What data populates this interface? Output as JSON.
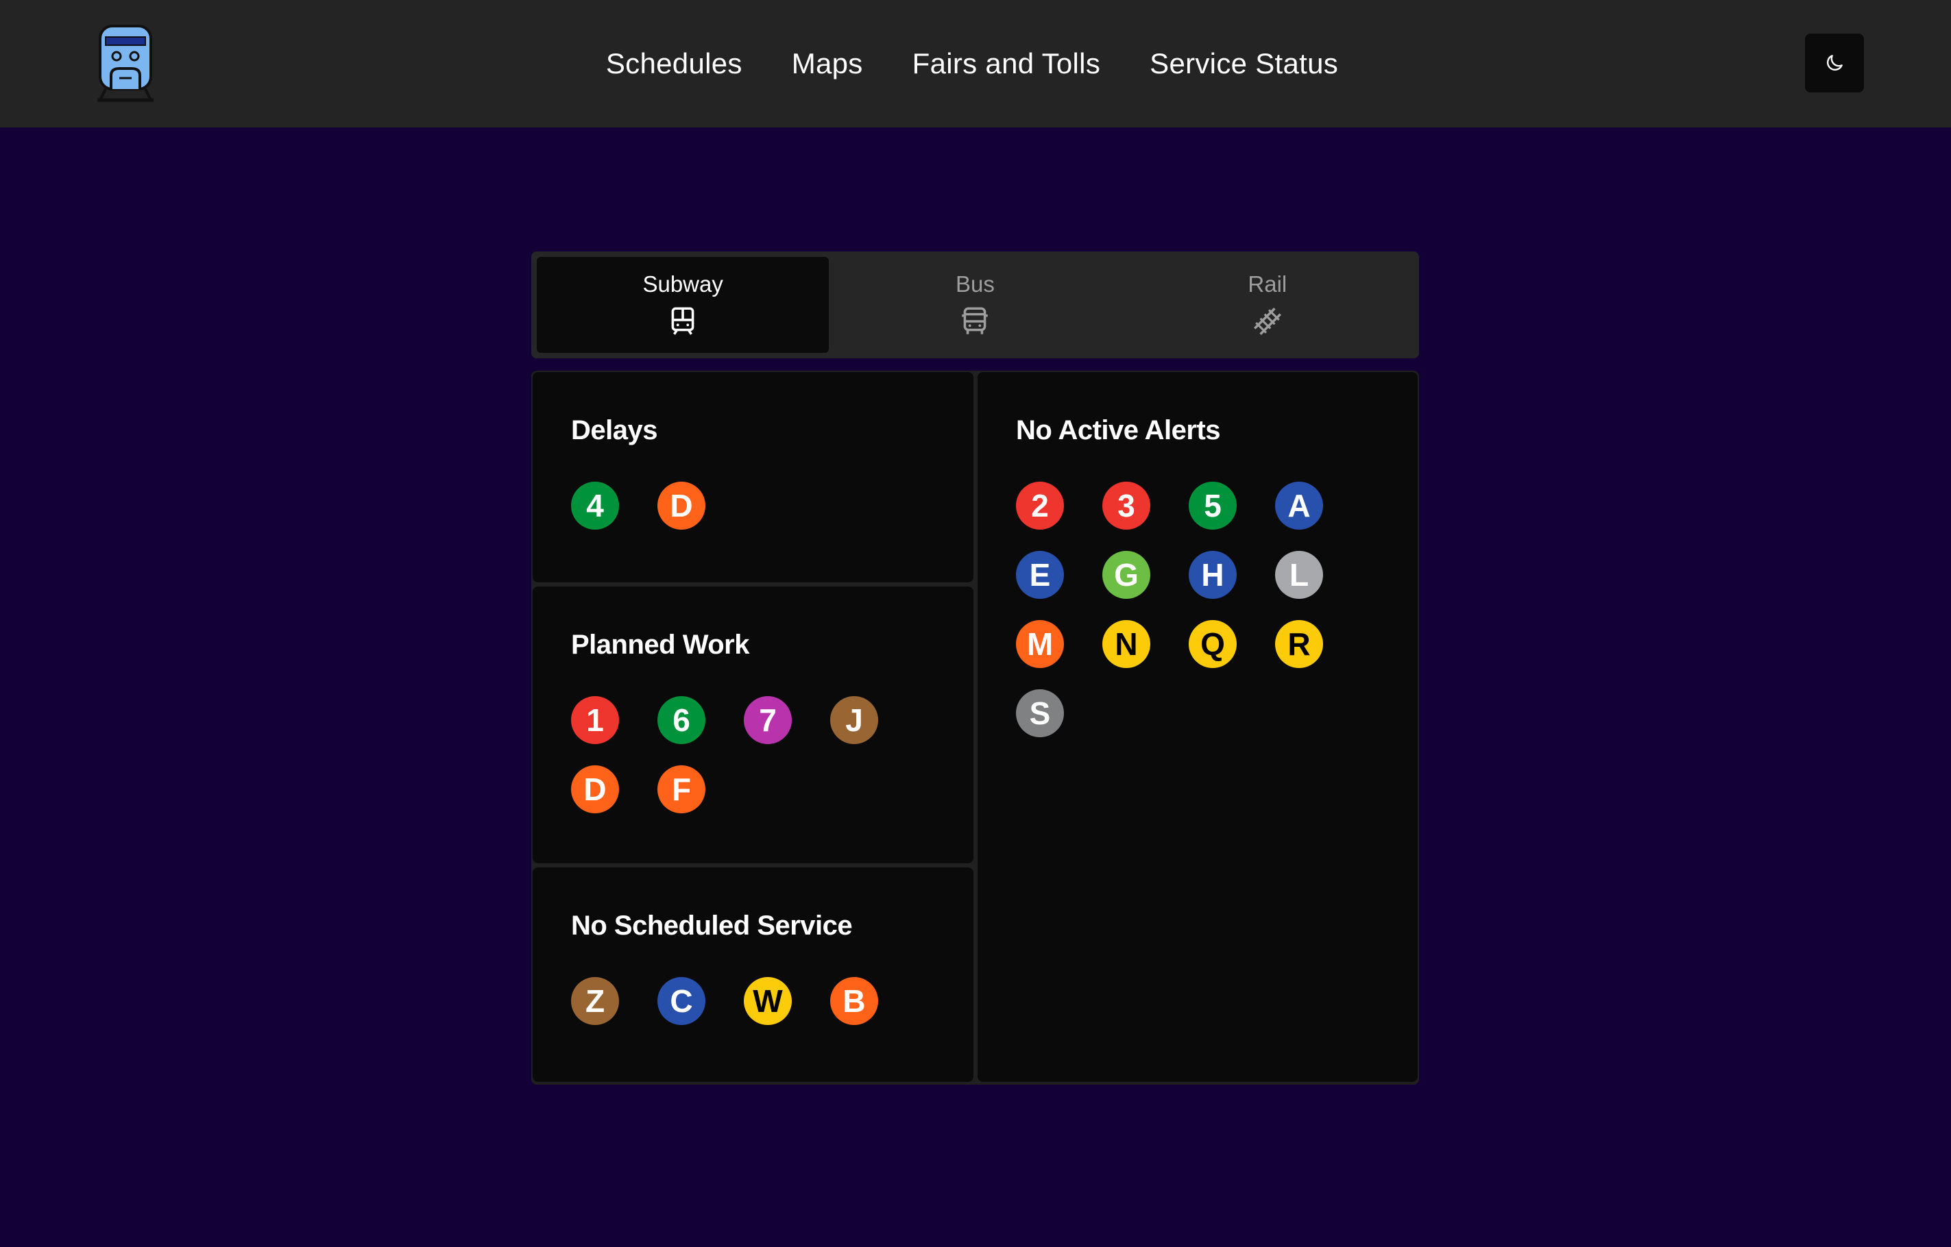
{
  "nav": {
    "links": [
      "Schedules",
      "Maps",
      "Fairs and Tolls",
      "Service Status"
    ],
    "logo_icon": "train-logo-icon",
    "theme_toggle_icon": "moon-icon"
  },
  "tabs": [
    {
      "label": "Subway",
      "icon": "subway-icon",
      "active": true
    },
    {
      "label": "Bus",
      "icon": "bus-icon",
      "active": false
    },
    {
      "label": "Rail",
      "icon": "rail-track-icon",
      "active": false
    }
  ],
  "panels": {
    "delays": {
      "title": "Delays",
      "lines": [
        {
          "label": "4",
          "color": "#00933c",
          "text": "#ffffff"
        },
        {
          "label": "D",
          "color": "#ff6319",
          "text": "#ffffff"
        }
      ]
    },
    "planned_work": {
      "title": "Planned Work",
      "lines": [
        {
          "label": "1",
          "color": "#ee352e",
          "text": "#ffffff"
        },
        {
          "label": "6",
          "color": "#00933c",
          "text": "#ffffff"
        },
        {
          "label": "7",
          "color": "#b933ad",
          "text": "#ffffff"
        },
        {
          "label": "J",
          "color": "#996633",
          "text": "#ffffff"
        },
        {
          "label": "D",
          "color": "#ff6319",
          "text": "#ffffff"
        },
        {
          "label": "F",
          "color": "#ff6319",
          "text": "#ffffff"
        }
      ]
    },
    "no_scheduled_service": {
      "title": "No Scheduled Service",
      "lines": [
        {
          "label": "Z",
          "color": "#996633",
          "text": "#ffffff"
        },
        {
          "label": "C",
          "color": "#2850ad",
          "text": "#ffffff"
        },
        {
          "label": "W",
          "color": "#fccc0a",
          "text": "#000000"
        },
        {
          "label": "B",
          "color": "#ff6319",
          "text": "#ffffff"
        }
      ]
    },
    "no_active_alerts": {
      "title": "No Active Alerts",
      "lines": [
        {
          "label": "2",
          "color": "#ee352e",
          "text": "#ffffff"
        },
        {
          "label": "3",
          "color": "#ee352e",
          "text": "#ffffff"
        },
        {
          "label": "5",
          "color": "#00933c",
          "text": "#ffffff"
        },
        {
          "label": "A",
          "color": "#2850ad",
          "text": "#ffffff"
        },
        {
          "label": "E",
          "color": "#2850ad",
          "text": "#ffffff"
        },
        {
          "label": "G",
          "color": "#6cbe45",
          "text": "#ffffff"
        },
        {
          "label": "H",
          "color": "#2850ad",
          "text": "#ffffff"
        },
        {
          "label": "L",
          "color": "#a7a9ac",
          "text": "#ffffff"
        },
        {
          "label": "M",
          "color": "#ff6319",
          "text": "#ffffff"
        },
        {
          "label": "N",
          "color": "#fccc0a",
          "text": "#000000"
        },
        {
          "label": "Q",
          "color": "#fccc0a",
          "text": "#000000"
        },
        {
          "label": "R",
          "color": "#fccc0a",
          "text": "#000000"
        },
        {
          "label": "S",
          "color": "#808183",
          "text": "#ffffff"
        }
      ]
    }
  }
}
